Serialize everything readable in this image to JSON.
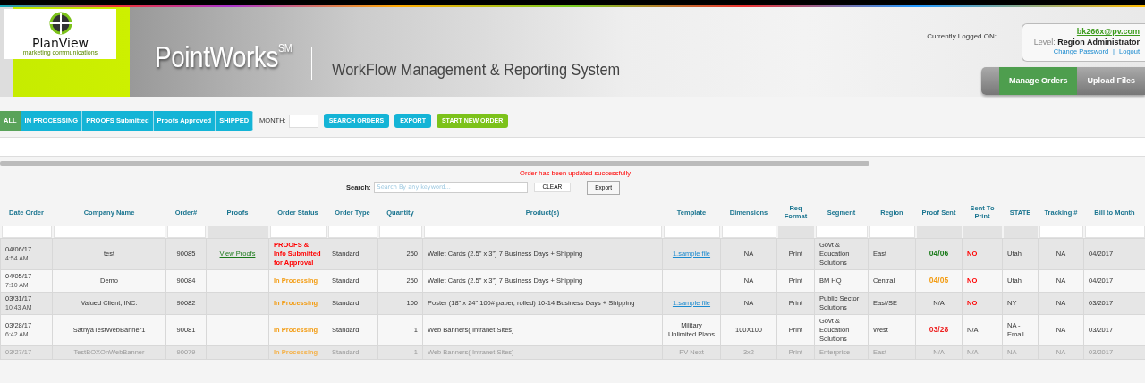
{
  "header": {
    "logo": {
      "name": "PlanView",
      "tagline": "marketing communications"
    },
    "brand": "PointWorks$^{SM}$",
    "subtitle": "WorkFlow Management & Reporting System"
  },
  "account": {
    "label": "Currently Logged ON:",
    "email": "bk266x@pv.com",
    "level_label": "Level:",
    "level": "Region Administrator",
    "links": [
      "Change Password",
      "Logout"
    ],
    "separator": "|"
  },
  "main_nav": [
    {
      "label": "Manage Orders",
      "selected": true
    },
    {
      "label": "Upload Files",
      "selected": false
    }
  ],
  "filters": [
    {
      "label": "ALL",
      "selected": true
    },
    {
      "label": "IN PROCESSING",
      "selected": false
    },
    {
      "label": "PROOFS Submitted",
      "selected": false
    },
    {
      "label": "Proofs Approved",
      "selected": false
    },
    {
      "label": "SHIPPED",
      "selected": false
    }
  ],
  "month_label": "MONTH:",
  "actions": [
    {
      "label": "SEARCH ORDERS",
      "kind": "info"
    },
    {
      "label": "EXPORT",
      "kind": "info"
    },
    {
      "label": "START NEW ORDER",
      "kind": "primary"
    }
  ],
  "message": "Order has been updated successfully",
  "search": {
    "label": "Search:",
    "placeholder": "Search By any keyword...",
    "clear": "CLEAR",
    "export": "Export"
  },
  "table": {
    "columns": [
      {
        "label": "Date Order",
        "filter": true
      },
      {
        "label": "Company Name",
        "filter": true
      },
      {
        "label": "Order#",
        "filter": true
      },
      {
        "label": "Proofs",
        "filter": false
      },
      {
        "label": "Order Status",
        "filter": true
      },
      {
        "label": "Order Type",
        "filter": true
      },
      {
        "label": "Quantity",
        "filter": true
      },
      {
        "label": "Product(s)",
        "filter": true
      },
      {
        "label": "Template",
        "filter": true
      },
      {
        "label": "Dimensions",
        "filter": true
      },
      {
        "label": "Req Format",
        "filter": false
      },
      {
        "label": "Segment",
        "filter": true
      },
      {
        "label": "Region",
        "filter": true
      },
      {
        "label": "Proof Sent",
        "filter": false
      },
      {
        "label": "Sent To Print",
        "filter": false
      },
      {
        "label": "STATE",
        "filter": false
      },
      {
        "label": "Tracking #",
        "filter": true
      },
      {
        "label": "Bill to Month",
        "filter": true
      }
    ],
    "rows": [
      {
        "date": "04/06/17",
        "time": "4:54 AM",
        "company": "test",
        "order": "90085",
        "proofs": "View Proofs",
        "status": {
          "text": "PROOFS & Info Submitted for Approval",
          "kind": "submitted"
        },
        "type": "Standard",
        "quantity": "250",
        "product": "Wallet Cards (2.5\" x 3\") 7 Business Days + Shipping",
        "template": {
          "text": "1.sample file",
          "link": true
        },
        "dimensions": "NA",
        "format": "Print",
        "segment": "Govt & Education Solutions",
        "region": "East",
        "proof_sent": {
          "text": "04/06",
          "color": "#1a7a1a"
        },
        "sent_to_print": {
          "text": "NO",
          "alert": true
        },
        "state": "Utah",
        "tracking": "NA",
        "bill": "04/2017"
      },
      {
        "date": "04/05/17",
        "time": "7:10 AM",
        "company": "Demo",
        "order": "90084",
        "status": {
          "text": "In Processing",
          "kind": "processing"
        },
        "type": "Standard",
        "quantity": "250",
        "product": "Wallet Cards (2.5\" x 3\") 7 Business Days + Shipping",
        "dimensions": "NA",
        "format": "Print",
        "segment": "BM HQ",
        "region": "Central",
        "proof_sent": {
          "text": "04/05",
          "color": "#f39c12"
        },
        "sent_to_print": {
          "text": "NO",
          "alert": true
        },
        "state": "Utah",
        "tracking": "NA",
        "bill": "04/2017"
      },
      {
        "date": "03/31/17",
        "time": "10:43 AM",
        "company": "Valued Client, INC.",
        "order": "90082",
        "status": {
          "text": "In Processing",
          "kind": "processing"
        },
        "type": "Standard",
        "quantity": "100",
        "product": "Poster (18\" x 24\" 100# paper, rolled) 10-14 Business Days + Shipping",
        "template": {
          "text": "1.sample file",
          "link": true
        },
        "dimensions": "NA",
        "format": "Print",
        "segment": "Public Sector Solutions",
        "region": "East/SE",
        "proof_sent": {
          "text": "N/A"
        },
        "sent_to_print": {
          "text": "NO",
          "alert": true
        },
        "state": "NY",
        "tracking": "NA",
        "bill": "03/2017"
      },
      {
        "date": "03/28/17",
        "time": "6:42 AM",
        "company": "SathyaTestWebBanner1",
        "order": "90081",
        "status": {
          "text": "In Processing",
          "kind": "processing"
        },
        "type": "Standard",
        "quantity": "1",
        "product": "Web Banners( Intranet Sites)",
        "template": {
          "text": "Military Unlimited Plans",
          "link": false
        },
        "dimensions": "100X100",
        "format": "Print",
        "segment": "Govt & Education Solutions",
        "region": "West",
        "proof_sent": {
          "text": "03/28",
          "color": "#ee2222"
        },
        "sent_to_print": {
          "text": "N/A",
          "alert": false
        },
        "state": "NA - Email",
        "tracking": "NA",
        "bill": "03/2017"
      },
      {
        "date": "03/27/17",
        "company": "TestBOXOnWebBanner",
        "order": "90079",
        "status": {
          "text": "In Processing",
          "kind": "processing"
        },
        "type": "Standard",
        "quantity": "1",
        "product": "Web Banners( Intranet Sites)",
        "template": {
          "text": "PV Next",
          "link": false
        },
        "dimensions": "3x2",
        "format": "Print",
        "segment": "Enterprise",
        "region": "East",
        "proof_sent": {
          "text": "N/A"
        },
        "sent_to_print": {
          "text": "N/A",
          "alert": false
        },
        "state": "NA -",
        "tracking": "NA",
        "bill": "03/2017"
      }
    ]
  }
}
